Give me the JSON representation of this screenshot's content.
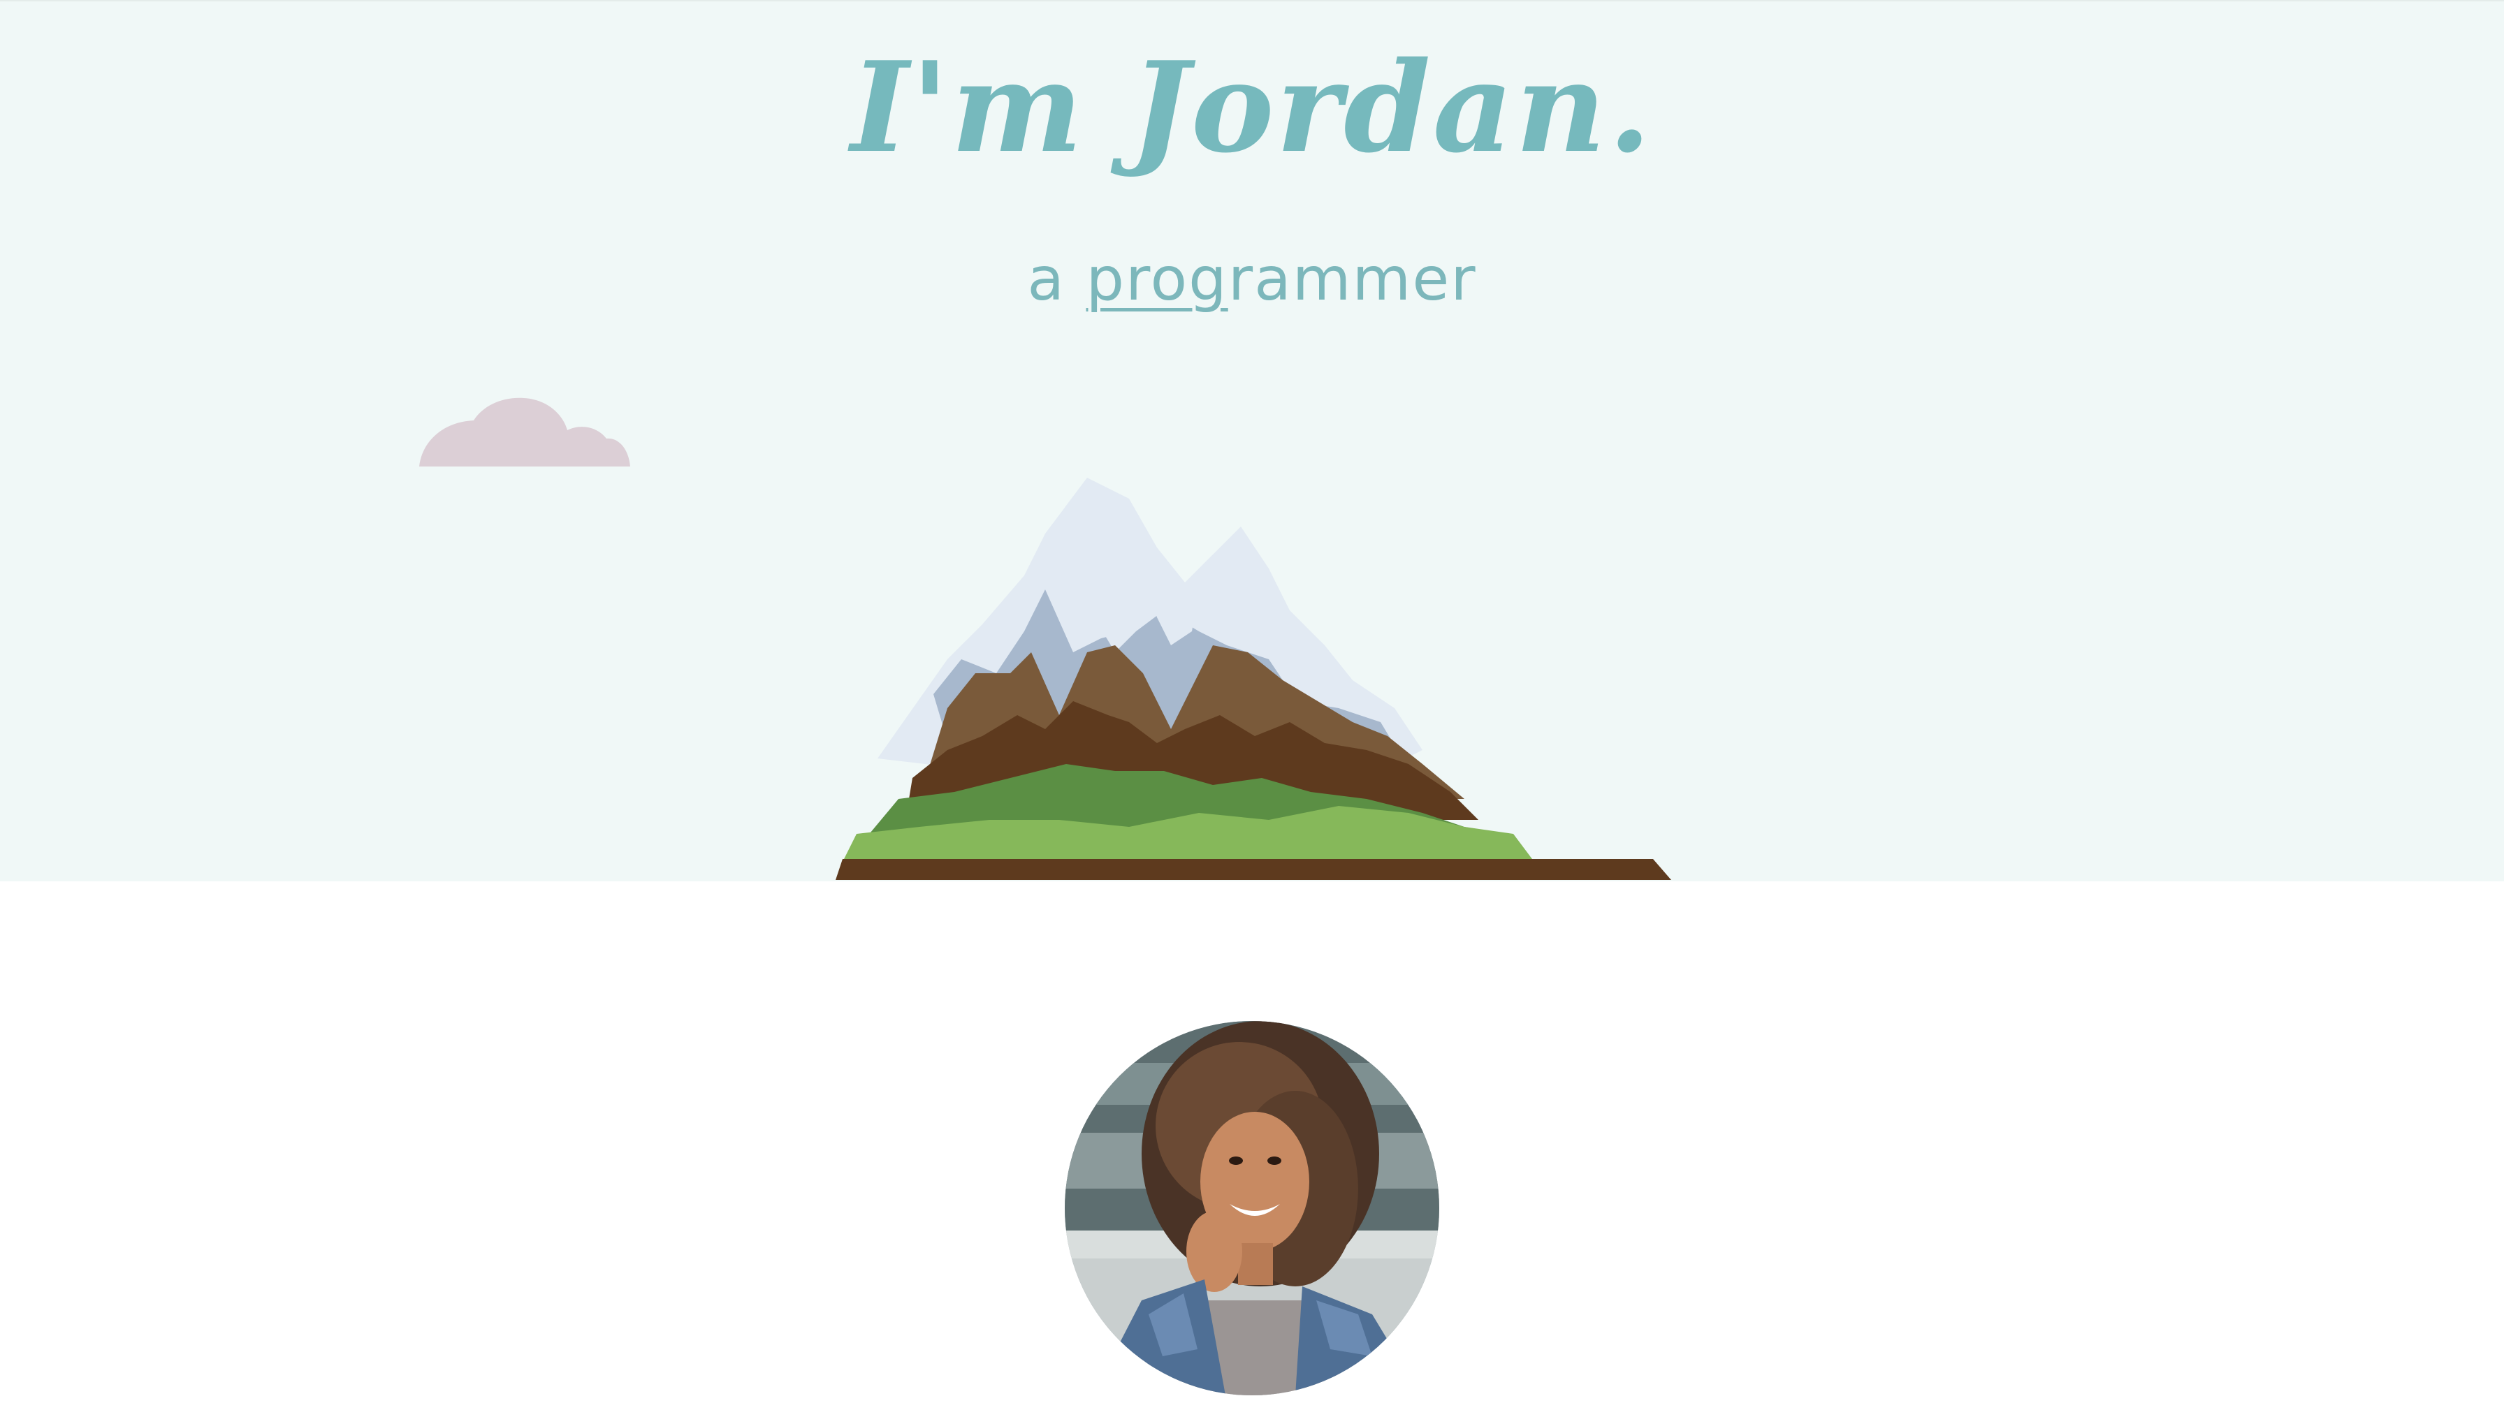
{
  "hero": {
    "title": "I'm Jordan.",
    "tagline_prefix": "a",
    "tagline_typed": "prog",
    "tagline_rest": "rammer"
  },
  "colors": {
    "accent": "#76b9bd",
    "hero_background": "#f0f8f7",
    "cloud": "#dccfd6",
    "snow": "#e2eaf3",
    "rock_shadow": "#a7b8cd",
    "earth_light": "#7a5a3a",
    "earth_dark": "#5e3a1e",
    "grass_dark": "#5b8f44",
    "grass_light": "#86b85a"
  },
  "icons": {
    "cloud": "cloud-icon",
    "mountain": "mountain-illustration",
    "avatar": "profile-photo"
  }
}
